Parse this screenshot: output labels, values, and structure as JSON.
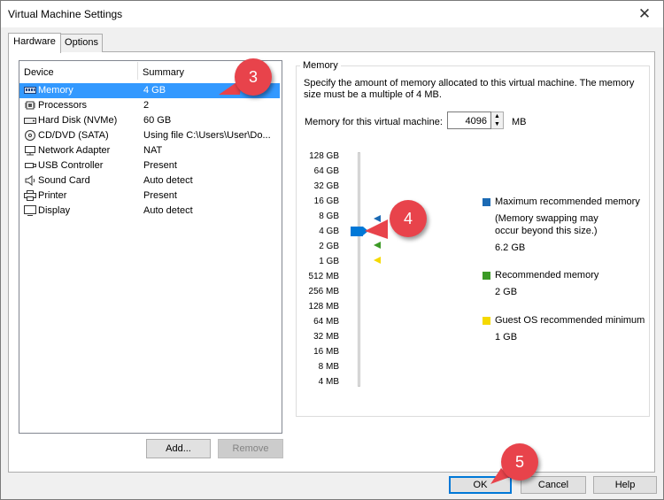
{
  "window": {
    "title": "Virtual Machine Settings",
    "close_glyph": "✕"
  },
  "tabs": [
    {
      "label": "Hardware"
    },
    {
      "label": "Options"
    }
  ],
  "device_list": {
    "columns": {
      "device": "Device",
      "summary": "Summary"
    },
    "rows": [
      {
        "name": "Memory",
        "summary": "4 GB",
        "icon": "memory-icon"
      },
      {
        "name": "Processors",
        "summary": "2",
        "icon": "processor-icon"
      },
      {
        "name": "Hard Disk (NVMe)",
        "summary": "60 GB",
        "icon": "hard-disk-icon"
      },
      {
        "name": "CD/DVD (SATA)",
        "summary": "Using file C:\\Users\\User\\Do...",
        "icon": "cd-dvd-icon"
      },
      {
        "name": "Network Adapter",
        "summary": "NAT",
        "icon": "network-adapter-icon"
      },
      {
        "name": "USB Controller",
        "summary": "Present",
        "icon": "usb-icon"
      },
      {
        "name": "Sound Card",
        "summary": "Auto detect",
        "icon": "speaker-icon"
      },
      {
        "name": "Printer",
        "summary": "Present",
        "icon": "printer-icon"
      },
      {
        "name": "Display",
        "summary": "Auto detect",
        "icon": "display-icon"
      }
    ],
    "selected": "Memory"
  },
  "buttons": {
    "add": "Add...",
    "remove": "Remove",
    "ok": "OK",
    "cancel": "Cancel",
    "help": "Help"
  },
  "memory": {
    "group_label": "Memory",
    "description": "Specify the amount of memory allocated to this virtual machine. The memory size must be a multiple of 4 MB.",
    "field_label": "Memory for this virtual machine:",
    "value": "4096",
    "unit": "MB",
    "slider_ticks": [
      "128 GB",
      "64 GB",
      "32 GB",
      "16 GB",
      "8 GB",
      "4 GB",
      "2 GB",
      "1 GB",
      "512 MB",
      "256 MB",
      "128 MB",
      "64 MB",
      "32 MB",
      "16 MB",
      "8 MB",
      "4 MB"
    ],
    "selected_tick": "4 GB",
    "legend": {
      "max": {
        "title": "Maximum recommended memory",
        "note": "(Memory swapping may occur beyond this size.)",
        "value": "6.2 GB",
        "color": "#1b6ab4"
      },
      "recommended": {
        "title": "Recommended memory",
        "value": "2 GB",
        "color": "#3c9a26"
      },
      "guest_min": {
        "title": "Guest OS recommended minimum",
        "value": "1 GB",
        "color": "#f5d900"
      }
    }
  },
  "callouts": [
    "3",
    "4",
    "5"
  ]
}
